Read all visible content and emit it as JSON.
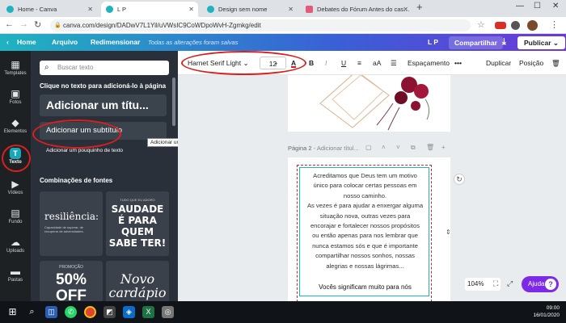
{
  "browser": {
    "tabs": [
      {
        "title": "Home - Canva",
        "favicon_color": "#1fb3c0",
        "active": false
      },
      {
        "title": "L P",
        "favicon_color": "#1fb3c0",
        "active": true
      },
      {
        "title": "Design sem nome",
        "favicon_color": "#1fb3c0",
        "active": false
      },
      {
        "title": "Debates do Fórum Antes do cas…",
        "favicon_color": "#e45a7a",
        "active": false
      }
    ],
    "new_tab": "+",
    "url": "canva.com/design/DADwV7L1Yil/uVWsIC9CoWDpoWvH-Zgmkg/edit",
    "window_controls": [
      "—",
      "☐",
      "✕"
    ]
  },
  "canva_header": {
    "home": "Home",
    "file": "Arquivo",
    "resize": "Redimensionar",
    "saved_status": "Todas as alterações foram salvas",
    "user_initials": "L P",
    "share": "Compartilhar",
    "publish": "Publicar"
  },
  "rail": [
    {
      "label": "Templates",
      "icon": "templates-icon",
      "glyph": "▦"
    },
    {
      "label": "Fotos",
      "icon": "photos-icon",
      "glyph": "▣"
    },
    {
      "label": "Elementos",
      "icon": "elements-icon",
      "glyph": "◆"
    },
    {
      "label": "Texto",
      "icon": "text-icon",
      "glyph": "T"
    },
    {
      "label": "Vídeos",
      "icon": "video-icon",
      "glyph": "▶"
    },
    {
      "label": "Fundo",
      "icon": "background-icon",
      "glyph": "▤"
    },
    {
      "label": "Uploads",
      "icon": "upload-icon",
      "glyph": "☁"
    },
    {
      "label": "Pastas",
      "icon": "folder-icon",
      "glyph": "▬"
    }
  ],
  "panel": {
    "search_placeholder": "Buscar texto",
    "hint": "Clique no texto para adicioná-lo à página",
    "add_heading": "Adicionar um títu...",
    "add_subheading": "Adicionar um subtítulo",
    "add_body": "Adicionar um pouquinho de texto",
    "font_combos_title": "Combinações de fontes",
    "cards": [
      {
        "main": "resiliência:",
        "sub": "Capacidade de superar, de recuperar de adversidades."
      },
      {
        "top": "TUDO QUE EU ADORO",
        "main": "SAUDADE É PARA QUEM SABE TER!"
      },
      {
        "top": "PROMOÇÃO",
        "main": "50% OFF"
      },
      {
        "main": "Novo cardápio"
      }
    ]
  },
  "tooltip": "Adicionar um subtítulo",
  "toolbar": {
    "font": "Harnet Serif Light",
    "size": "12",
    "bold": "B",
    "italic": "I",
    "underline": "U",
    "case": "aA",
    "spacing": "Espaçamento",
    "more": "•••",
    "duplicate": "Duplicar",
    "position": "Posição"
  },
  "page2_label": "Página 2",
  "page2_title_placeholder": "- Adicionar títul...",
  "page_text": [
    "Acreditamos que Deus tem um motivo",
    "único para colocar certas pessoas em",
    "nosso caminho.",
    "As vezes é para ajudar a enxergar alguma",
    "situação nova, outras vezes para",
    "encorajar e fortalecer nossos propósitos",
    "ou então apenas para nos lembrar que",
    "nunca estamos sós e que é importante",
    "compartilhar nossos sonhos, nossas",
    "alegrias e nossas lágrimas..."
  ],
  "page_text_last": "Vocês significam muito para nós",
  "zoom": "104%",
  "help": "Ajuda",
  "help_q": "?",
  "taskbar": {
    "time": "09:00",
    "date": "16/01/2020"
  },
  "colors": {
    "header_gradient_start": "#1fb3c0",
    "header_gradient_end": "#6d38d8",
    "panel_bg": "#293039",
    "rail_bg": "#1e2124",
    "help_purple": "#7d2ae8",
    "annotation_red": "#d9201e"
  }
}
